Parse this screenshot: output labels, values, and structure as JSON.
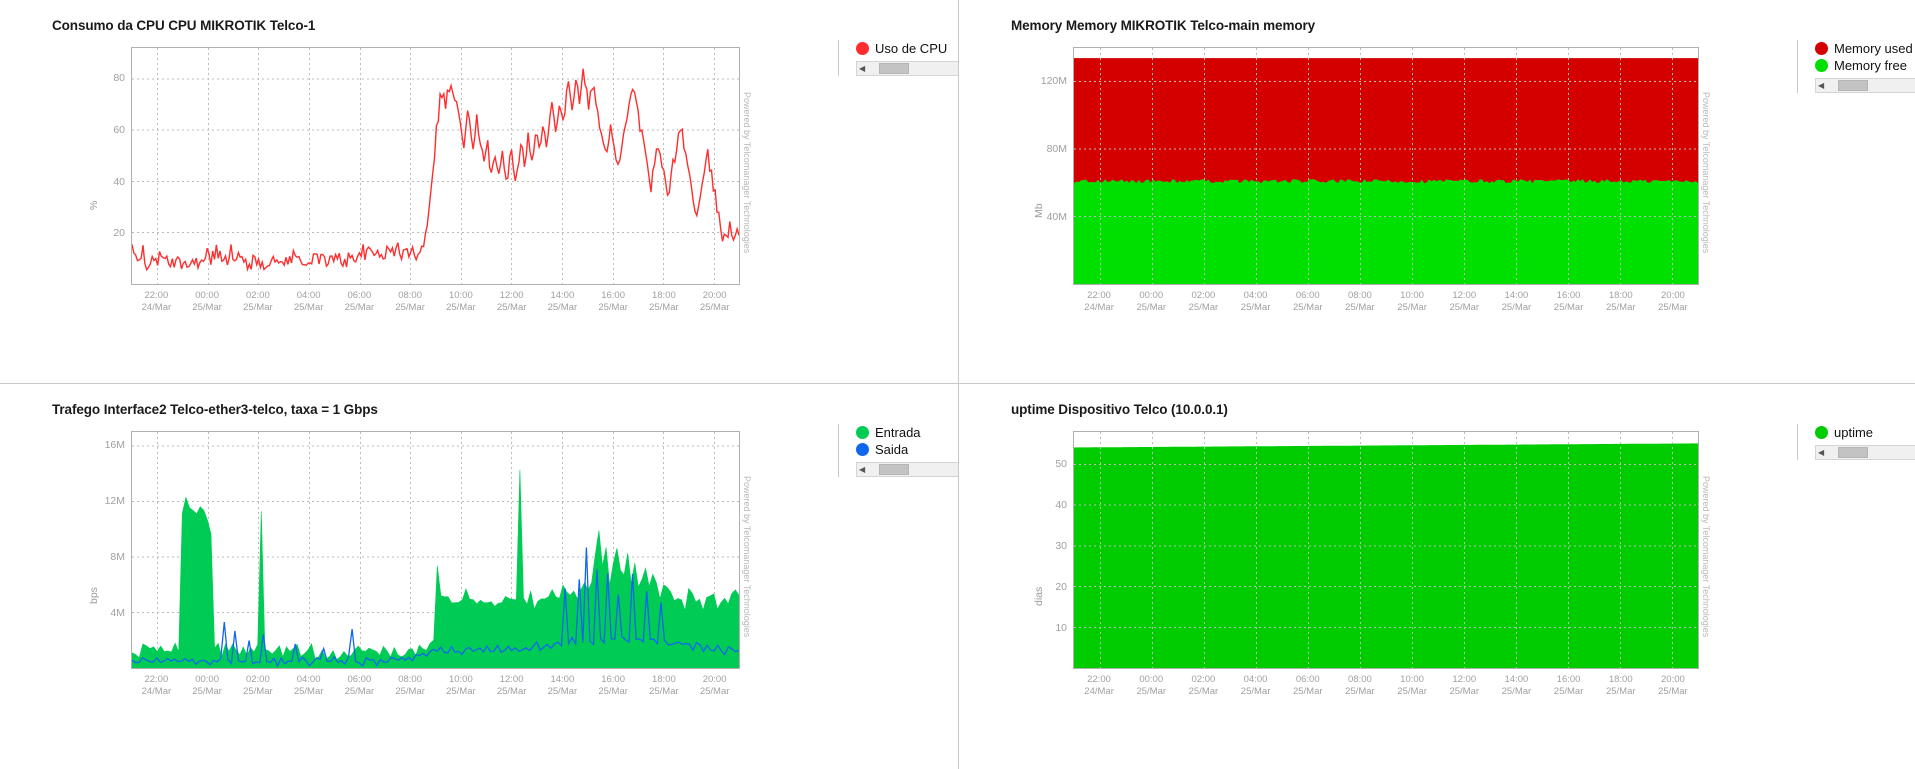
{
  "watermark": "Powered by Telcomanager Technologies",
  "xaxis": {
    "ticks": [
      {
        "time": "22:00",
        "date": "24/Mar"
      },
      {
        "time": "00:00",
        "date": "25/Mar"
      },
      {
        "time": "02:00",
        "date": "25/Mar"
      },
      {
        "time": "04:00",
        "date": "25/Mar"
      },
      {
        "time": "06:00",
        "date": "25/Mar"
      },
      {
        "time": "08:00",
        "date": "25/Mar"
      },
      {
        "time": "10:00",
        "date": "25/Mar"
      },
      {
        "time": "12:00",
        "date": "25/Mar"
      },
      {
        "time": "14:00",
        "date": "25/Mar"
      },
      {
        "time": "16:00",
        "date": "25/Mar"
      },
      {
        "time": "18:00",
        "date": "25/Mar"
      },
      {
        "time": "20:00",
        "date": "25/Mar"
      }
    ]
  },
  "scrollbar": {
    "left_arrow": "◀",
    "right_arrow": "▶"
  },
  "panels": {
    "cpu": {
      "title": "Consumo da CPU CPU MIKROTIK Telco-1",
      "legend": [
        {
          "label": "Uso de CPU",
          "color": "#ff2d2d",
          "icon": "legend-dot-icon"
        }
      ]
    },
    "memory": {
      "title": "Memory Memory MIKROTIK Telco-main memory",
      "legend": [
        {
          "label": "Memory used",
          "color": "#d40000",
          "icon": "legend-dot-icon"
        },
        {
          "label": "Memory free",
          "color": "#00e000",
          "icon": "legend-dot-icon"
        }
      ]
    },
    "traffic": {
      "title": "Trafego Interface2 Telco-ether3-telco, taxa = 1 Gbps",
      "legend": [
        {
          "label": "Entrada",
          "color": "#00cc55",
          "icon": "legend-dot-icon"
        },
        {
          "label": "Saida",
          "color": "#1166ee",
          "icon": "legend-dot-icon"
        }
      ]
    },
    "uptime": {
      "title": "uptime Dispositivo Telco (10.0.0.1)",
      "legend": [
        {
          "label": "uptime",
          "color": "#00cc00",
          "icon": "legend-dot-icon"
        }
      ]
    }
  },
  "chart_data": [
    {
      "id": "cpu",
      "type": "line",
      "title": "Consumo da CPU CPU MIKROTIK Telco-1",
      "xlabel": "",
      "ylabel": "%",
      "ylim": [
        0,
        92
      ],
      "yticks": [
        20,
        40,
        60,
        80
      ],
      "ytick_labels": [
        "20",
        "40",
        "60",
        "80"
      ],
      "grid": true,
      "legend_position": "right",
      "x_start": "22:00 24/Mar",
      "x_end": "20:00 25/Mar",
      "series": [
        {
          "name": "Uso de CPU",
          "color": "#ff2d2d",
          "values": [
            15,
            12,
            9,
            8,
            8,
            9,
            15,
            10,
            8,
            8,
            9,
            8,
            8,
            9,
            8,
            14,
            13,
            8,
            8,
            9,
            8,
            8,
            8,
            9,
            8,
            8,
            8,
            8,
            9,
            8,
            9,
            8,
            8,
            8,
            9,
            10,
            9,
            8,
            9,
            8,
            9,
            12,
            10,
            9,
            11,
            10,
            13,
            12,
            11,
            10,
            12,
            11,
            10,
            12,
            13,
            11,
            10,
            9,
            11,
            10,
            9,
            8,
            9,
            8,
            9,
            8,
            9,
            8,
            9,
            8,
            8,
            9,
            8,
            9,
            9,
            8,
            9,
            8,
            9,
            10,
            9,
            8,
            9,
            10,
            9,
            8,
            9,
            10,
            12,
            11,
            9,
            10,
            9,
            8,
            9,
            10,
            9,
            8,
            9,
            9,
            10,
            11,
            10,
            9,
            11,
            10,
            9,
            10,
            9,
            10,
            9,
            10,
            9,
            10,
            9,
            9,
            10,
            9,
            10,
            11,
            10,
            9,
            11,
            13,
            12,
            11,
            13,
            12,
            11,
            12,
            13,
            12,
            11,
            12,
            13,
            12,
            13,
            12,
            11,
            12,
            13,
            14,
            13,
            12,
            13,
            14,
            13,
            12,
            13,
            12,
            13,
            12,
            11,
            12,
            13,
            12,
            13,
            14,
            15,
            16,
            18,
            24,
            32,
            38,
            44,
            52,
            60,
            66,
            72,
            75,
            73,
            70,
            74,
            76,
            78,
            74,
            72,
            70,
            66,
            62,
            58,
            54,
            60,
            66,
            62,
            58,
            55,
            60,
            64,
            58,
            54,
            50,
            46,
            50,
            54,
            48,
            44,
            48,
            52,
            46,
            42,
            46,
            50,
            44,
            40,
            44,
            48,
            52,
            46,
            42,
            46,
            50,
            56,
            52,
            48,
            52,
            58,
            54,
            50,
            54,
            60,
            56,
            52,
            56,
            62,
            58,
            54,
            58,
            64,
            70,
            66,
            62,
            66,
            72,
            68,
            64,
            68,
            74,
            78,
            74,
            70,
            74,
            80,
            76,
            72,
            76,
            82,
            78,
            74,
            70,
            74,
            78,
            74,
            70,
            66,
            62,
            58,
            54,
            50,
            54,
            58,
            62,
            58,
            54,
            50,
            46,
            50,
            54,
            58,
            62,
            66,
            70,
            74,
            78,
            74,
            70,
            66,
            62,
            58,
            54,
            50,
            46,
            42,
            38,
            42,
            46,
            50,
            54,
            50,
            46,
            42,
            38,
            34,
            38,
            42,
            46,
            50,
            54,
            58,
            62,
            58,
            54,
            50,
            46,
            42,
            38,
            34,
            30,
            26,
            30,
            34,
            38,
            42,
            46,
            50,
            46,
            42,
            38,
            34,
            30,
            26,
            22,
            18,
            22,
            20,
            18,
            22,
            20,
            18,
            20,
            22,
            20
          ]
        }
      ]
    },
    {
      "id": "memory",
      "type": "area",
      "title": "Memory Memory MIKROTIK Telco-main memory",
      "xlabel": "",
      "ylabel": "Mb",
      "ylim": [
        0,
        140000000
      ],
      "yticks": [
        40000000,
        80000000,
        120000000
      ],
      "ytick_labels": [
        "40M",
        "80M",
        "120M"
      ],
      "grid": true,
      "legend_position": "right",
      "stacked": true,
      "x_start": "22:00 24/Mar",
      "x_end": "20:00 25/Mar",
      "series": [
        {
          "name": "Memory free",
          "color": "#00e000",
          "approx_constant": 61000000
        },
        {
          "name": "Memory used",
          "color": "#d40000",
          "approx_constant": 73000000
        }
      ],
      "total_approx": 134000000
    },
    {
      "id": "traffic",
      "type": "line",
      "title": "Trafego Interface2 Telco-ether3-telco, taxa = 1 Gbps",
      "xlabel": "",
      "ylabel": "bps",
      "ylim": [
        0,
        17000000
      ],
      "yticks": [
        4000000,
        8000000,
        12000000,
        16000000
      ],
      "ytick_labels": [
        "4M",
        "8M",
        "12M",
        "16M"
      ],
      "grid": true,
      "legend_position": "right",
      "x_start": "22:00 24/Mar",
      "x_end": "20:00 25/Mar",
      "series": [
        {
          "name": "Entrada",
          "color": "#00cc55",
          "filled": true,
          "peak": 14500000,
          "values": [
            1.0,
            1.2,
            0.9,
            1.4,
            1.1,
            1.3,
            1.0,
            1.5,
            1.2,
            1.0,
            1.3,
            1.1,
            1.4,
            1.2,
            11.0,
            11.8,
            11.5,
            11.2,
            10.8,
            11.4,
            11.0,
            10.5,
            9.8,
            1.6,
            1.2,
            1.0,
            1.4,
            1.1,
            1.3,
            1.0,
            1.2,
            1.5,
            1.1,
            1.3,
            1.0,
            1.2,
            11.2,
            1.4,
            1.1,
            1.3,
            1.0,
            1.2,
            0.9,
            1.1,
            1.3,
            1.0,
            1.2,
            0.9,
            1.1,
            1.0,
            1.2,
            0.9,
            1.1,
            1.0,
            0.9,
            1.1,
            1.0,
            0.9,
            1.1,
            1.0,
            0.9,
            1.1,
            1.2,
            1.0,
            0.9,
            1.1,
            1.0,
            0.9,
            1.1,
            1.0,
            1.2,
            1.1,
            1.0,
            0.9,
            1.1,
            1.0,
            1.2,
            1.1,
            1.3,
            1.0,
            1.2,
            1.4,
            1.1,
            1.3,
            1.5,
            6.8,
            5.4,
            4.8,
            5.2,
            4.6,
            5.0,
            4.4,
            4.8,
            5.2,
            4.6,
            5.0,
            4.4,
            4.8,
            4.2,
            4.6,
            5.0,
            4.4,
            4.8,
            4.2,
            4.6,
            5.0,
            4.4,
            4.8,
            13.8,
            5.2,
            4.6,
            5.0,
            4.4,
            4.8,
            5.2,
            4.6,
            5.0,
            5.4,
            4.8,
            5.2,
            5.6,
            5.0,
            5.4,
            5.8,
            5.2,
            5.6,
            6.0,
            5.4,
            5.8,
            8.2,
            9.4,
            7.6,
            8.8,
            6.2,
            7.4,
            8.6,
            6.8,
            7.0,
            8.2,
            6.4,
            7.6,
            5.8,
            6.0,
            7.2,
            5.4,
            6.6,
            5.8,
            5.0,
            6.2,
            5.4,
            5.6,
            4.8,
            5.0,
            5.2,
            4.4,
            5.6,
            4.8,
            5.0,
            5.2,
            4.4,
            4.6,
            4.8,
            5.0,
            4.2,
            4.4,
            4.6,
            4.8,
            5.0,
            5.2,
            5.4
          ]
        },
        {
          "name": "Saida",
          "color": "#1166ee",
          "filled": false,
          "peak": 9000000,
          "values": [
            0.4,
            0.5,
            0.3,
            0.6,
            0.4,
            0.5,
            0.3,
            0.6,
            0.4,
            0.3,
            0.5,
            0.4,
            0.6,
            0.4,
            0.5,
            0.6,
            0.4,
            0.5,
            0.3,
            0.6,
            0.4,
            0.5,
            0.3,
            0.6,
            0.4,
            0.5,
            3.2,
            0.6,
            0.4,
            2.8,
            0.5,
            0.3,
            0.6,
            1.8,
            0.4,
            0.5,
            0.3,
            2.4,
            0.6,
            0.4,
            0.5,
            0.3,
            0.6,
            0.4,
            0.5,
            0.3,
            1.6,
            0.4,
            0.6,
            0.5,
            0.3,
            0.4,
            0.6,
            0.5,
            1.2,
            0.4,
            0.3,
            0.6,
            0.5,
            0.4,
            0.3,
            0.6,
            2.6,
            0.5,
            0.4,
            0.3,
            0.6,
            0.5,
            0.4,
            0.3,
            0.6,
            0.5,
            0.4,
            0.6,
            0.5,
            0.4,
            0.6,
            0.5,
            0.7,
            0.6,
            0.8,
            0.7,
            0.9,
            0.8,
            1.0,
            1.2,
            1.1,
            1.3,
            1.0,
            1.2,
            1.4,
            1.1,
            1.3,
            1.0,
            1.2,
            1.4,
            1.1,
            1.3,
            1.5,
            1.2,
            1.4,
            1.1,
            1.3,
            1.5,
            1.2,
            1.4,
            1.6,
            1.3,
            1.5,
            1.2,
            1.4,
            1.6,
            1.3,
            1.5,
            1.7,
            1.4,
            1.6,
            1.8,
            1.5,
            1.7,
            1.9,
            1.6,
            5.8,
            1.8,
            2.0,
            1.7,
            6.4,
            1.9,
            8.8,
            2.0,
            1.8,
            7.2,
            2.1,
            1.9,
            6.6,
            2.2,
            2.0,
            5.4,
            2.3,
            2.1,
            1.9,
            6.8,
            2.2,
            2.0,
            1.8,
            5.6,
            2.1,
            1.9,
            1.7,
            4.8,
            2.0,
            1.8,
            1.6,
            1.9,
            1.7,
            1.5,
            1.8,
            1.6,
            1.4,
            1.7,
            1.5,
            1.3,
            1.6,
            1.4,
            1.2,
            1.5,
            1.3,
            1.1,
            1.4,
            1.2,
            1.0,
            1.3
          ]
        }
      ]
    },
    {
      "id": "uptime",
      "type": "area",
      "title": "uptime Dispositivo Telco (10.0.0.1)",
      "xlabel": "",
      "ylabel": "dias",
      "ylim": [
        0,
        58
      ],
      "yticks": [
        10,
        20,
        30,
        40,
        50
      ],
      "ytick_labels": [
        "10",
        "20",
        "30",
        "40",
        "50"
      ],
      "grid": true,
      "legend_position": "right",
      "x_start": "22:00 24/Mar",
      "x_end": "20:00 25/Mar",
      "series": [
        {
          "name": "uptime",
          "color": "#00cc00",
          "start_value": 54.2,
          "end_value": 55.2
        }
      ]
    }
  ]
}
